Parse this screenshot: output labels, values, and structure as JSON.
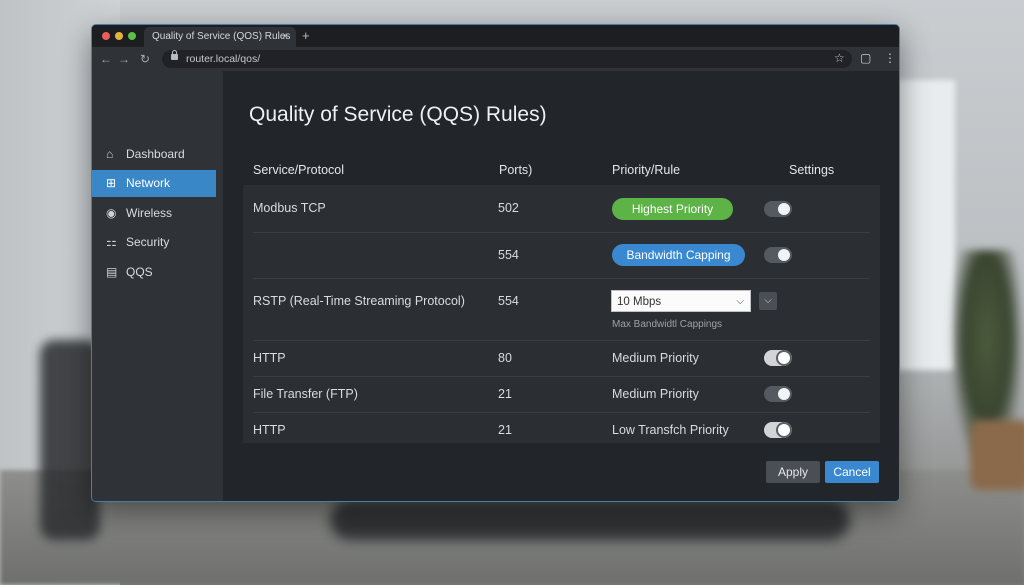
{
  "browser": {
    "tab_title": "Quality of Service (QOS) Rules",
    "tab_close": "×",
    "new_tab": "+",
    "url": "router.local/qos/"
  },
  "sidebar": {
    "items": [
      {
        "label": "Dashboard",
        "icon": "home-icon",
        "glyph": "⌂"
      },
      {
        "label": "Network",
        "icon": "network-icon",
        "glyph": "⊞",
        "active": true
      },
      {
        "label": "Wireless",
        "icon": "wireless-icon",
        "glyph": "◉"
      },
      {
        "label": "Security",
        "icon": "security-icon",
        "glyph": "⚏"
      },
      {
        "label": "QQS",
        "icon": "qos-icon",
        "glyph": "▤"
      }
    ]
  },
  "main": {
    "title": "Quality of Service (QQS) Rules)",
    "columns": [
      "Service/Protocol",
      "Ports)",
      "Priority/Rule",
      "Settings"
    ],
    "rows": [
      {
        "service": "Modbus TCP",
        "port": "502",
        "rule": "Highest Priority",
        "rule_type": "green-pill",
        "toggle": "off"
      },
      {
        "service": "",
        "port": "554",
        "rule": "Bandwidth Capping",
        "rule_type": "blue-pill",
        "toggle": "off"
      },
      {
        "service": "RSTP (Real-Time Streaming Protocol)",
        "port": "554",
        "rule": "10 Mbps",
        "rule_type": "select",
        "hint": "Max Bandwidtl Cappings"
      },
      {
        "service": "HTTP",
        "port": "80",
        "rule": "Medium Priority",
        "rule_type": "text",
        "toggle": "on"
      },
      {
        "service": "File Transfer (FTP)",
        "port": "21",
        "rule": "Medium Priority",
        "rule_type": "text",
        "toggle": "off"
      },
      {
        "service": "HTTP",
        "port": "21",
        "rule": "Low Transfch Priority",
        "rule_type": "text",
        "toggle": "on"
      }
    ],
    "apply_label": "Apply",
    "cancel_label": "Cancel"
  },
  "colors": {
    "accent": "#3a88cf",
    "success": "#5db346",
    "window_bg": "#26292e"
  }
}
